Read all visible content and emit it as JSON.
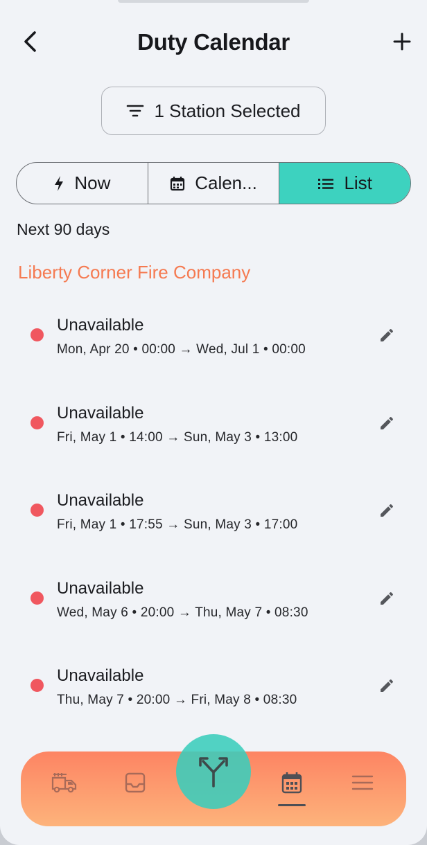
{
  "header": {
    "title": "Duty Calendar",
    "back_icon": "chevron-left-icon",
    "add_icon": "plus-icon"
  },
  "filter": {
    "label": "1 Station Selected",
    "icon": "filter-icon"
  },
  "segments": [
    {
      "label": "Now",
      "icon": "bolt-icon",
      "active": false
    },
    {
      "label": "Calen...",
      "icon": "calendar-icon",
      "active": false
    },
    {
      "label": "List",
      "icon": "list-icon",
      "active": true
    }
  ],
  "range_text": "Next 90 days",
  "company": "Liberty Corner Fire Company",
  "entries": [
    {
      "title": "Unavailable",
      "time": "Mon, Apr 20 • 00:00 → Wed, Jul 1 • 00:00"
    },
    {
      "title": "Unavailable",
      "time": "Fri, May 1 • 14:00 → Sun, May 3 • 13:00"
    },
    {
      "title": "Unavailable",
      "time": "Fri, May 1 • 17:55 → Sun, May 3 • 17:00"
    },
    {
      "title": "Unavailable",
      "time": "Wed, May 6 • 20:00 → Thu, May 7 • 08:30"
    },
    {
      "title": "Unavailable",
      "time": "Thu, May 7 • 20:00 → Fri, May 8 • 08:30"
    }
  ],
  "colors": {
    "accent": "#3dd2bf",
    "company": "#f57a51",
    "unavailable_dot": "#f0575f",
    "nav_gradient_top": "#fd8463",
    "nav_gradient_bottom": "#fdb37b"
  },
  "bottom_nav": {
    "items": [
      "fire-truck-icon",
      "inbox-icon",
      "calendar-icon",
      "menu-icon"
    ],
    "fab_icon": "fork-arrows-icon",
    "active": "calendar-icon"
  }
}
